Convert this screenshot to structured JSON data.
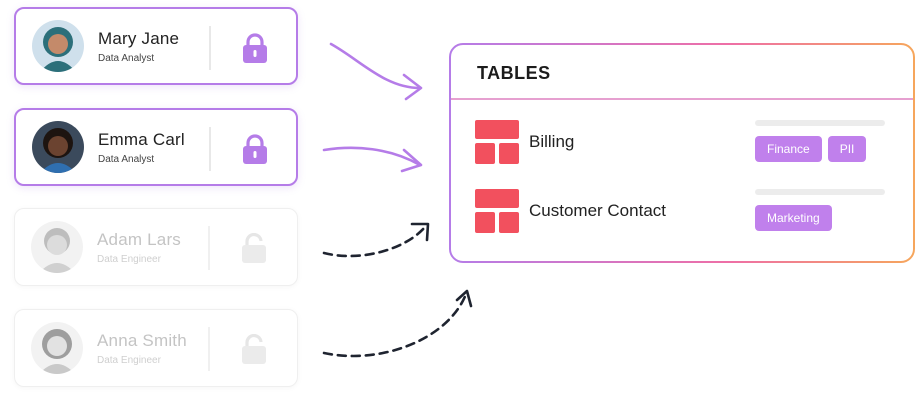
{
  "users": [
    {
      "name": "Mary Jane",
      "role": "Data Analyst",
      "state": "active",
      "skin": "#c48a6a",
      "hair": "#2c6f7a"
    },
    {
      "name": "Emma Carl",
      "role": "Data Analyst",
      "state": "active",
      "skin": "#6b4330",
      "hair": "#1d1410"
    },
    {
      "name": "Adam Lars",
      "role": "Data Engineer",
      "state": "inactive",
      "skin": "#dcdcdc",
      "hair": "#bdbdbd"
    },
    {
      "name": "Anna Smith",
      "role": "Data Engineer",
      "state": "inactive",
      "skin": "#e2e2e2",
      "hair": "#9e9e9e"
    }
  ],
  "panel": {
    "title": "TABLES",
    "tables": [
      {
        "name": "Billing",
        "tags": [
          "Finance",
          "PII"
        ]
      },
      {
        "name": "Customer Contact",
        "tags": [
          "Marketing"
        ]
      }
    ]
  },
  "colors": {
    "accent": "#b57ce8",
    "tag": "#c080ec",
    "table_icon": "#f2505e",
    "arrow_dashed": "#1f2430"
  },
  "icons": {
    "lock": "lock-icon",
    "table": "table-icon",
    "arrow": "arrow-icon"
  }
}
